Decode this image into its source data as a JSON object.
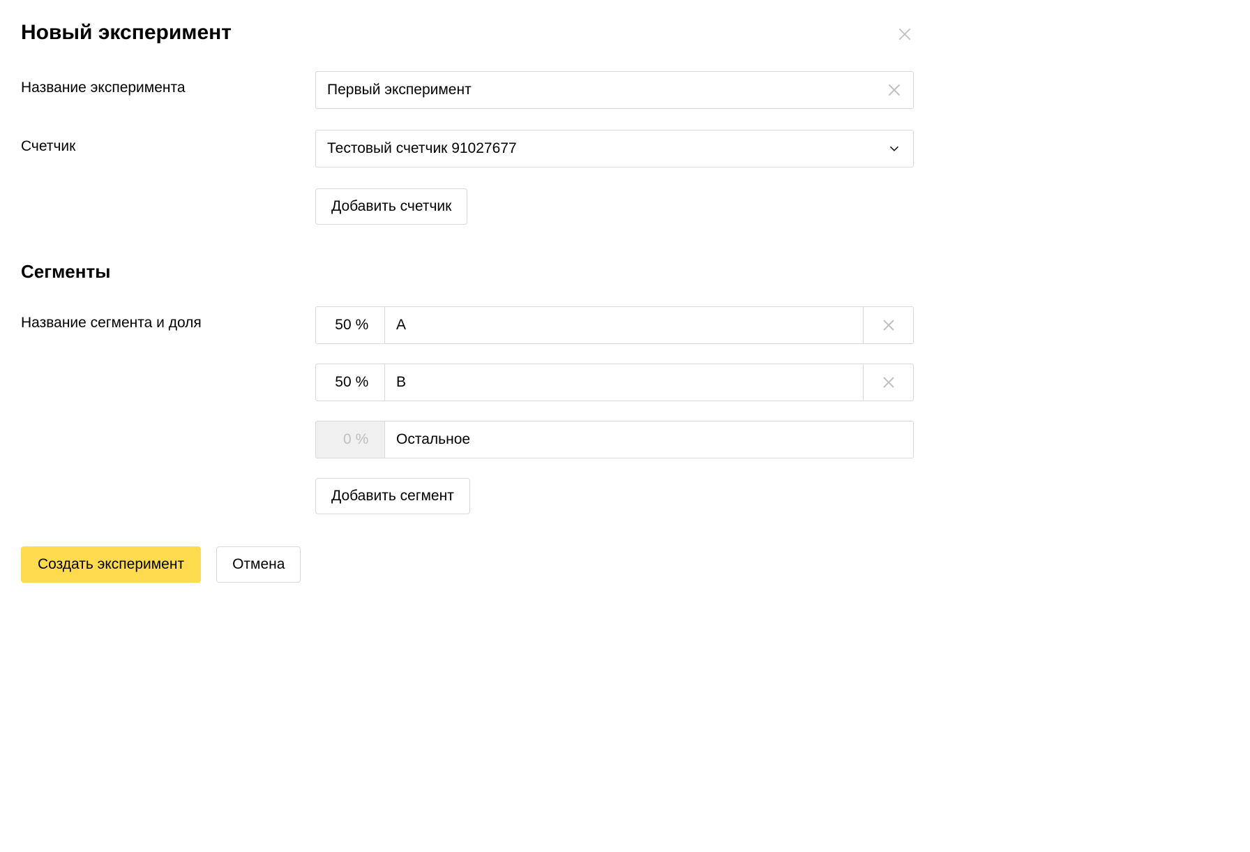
{
  "dialog": {
    "title": "Новый эксперимент"
  },
  "fields": {
    "name_label": "Название эксперимента",
    "name_value": "Первый эксперимент",
    "counter_label": "Счетчик",
    "counter_value": "Тестовый счетчик 91027677",
    "add_counter_label": "Добавить счетчик"
  },
  "segments": {
    "heading": "Сегменты",
    "row_label": "Название сегмента и доля",
    "percent_symbol": "%",
    "items": [
      {
        "percent": "50",
        "name": "A",
        "removable": true
      },
      {
        "percent": "50",
        "name": "B",
        "removable": true
      }
    ],
    "remainder": {
      "percent": "0",
      "name": "Остальное"
    },
    "add_segment_label": "Добавить сегмент"
  },
  "footer": {
    "submit_label": "Создать эксперимент",
    "cancel_label": "Отмена"
  }
}
